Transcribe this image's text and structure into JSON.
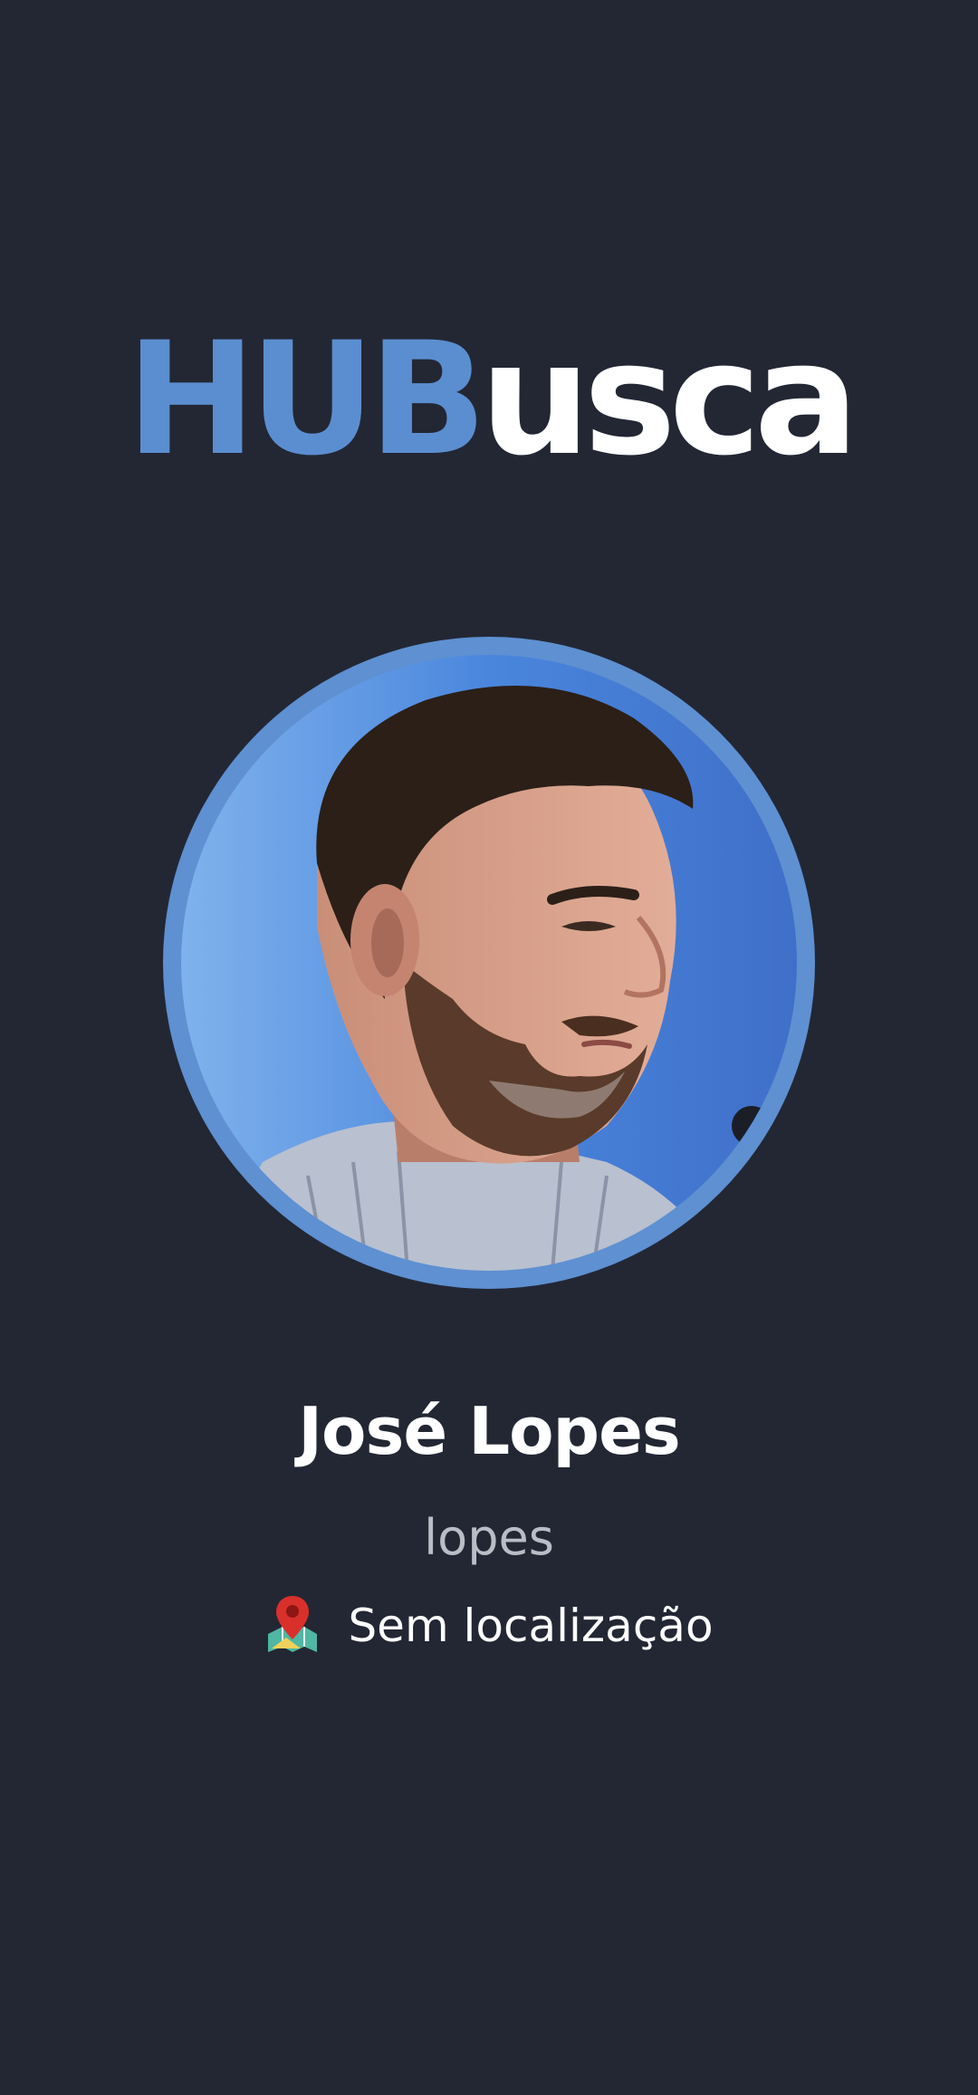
{
  "app": {
    "logo_primary": "HUB",
    "logo_secondary": "usca"
  },
  "profile": {
    "name": "José Lopes",
    "username": "lopes",
    "location": "Sem localização",
    "location_icon": "map-pin-icon",
    "avatar_alt": "José Lopes"
  },
  "colors": {
    "background": "#232734",
    "accent": "#5b8ed0",
    "text_primary": "#ffffff",
    "text_secondary": "#b9bdc6"
  }
}
